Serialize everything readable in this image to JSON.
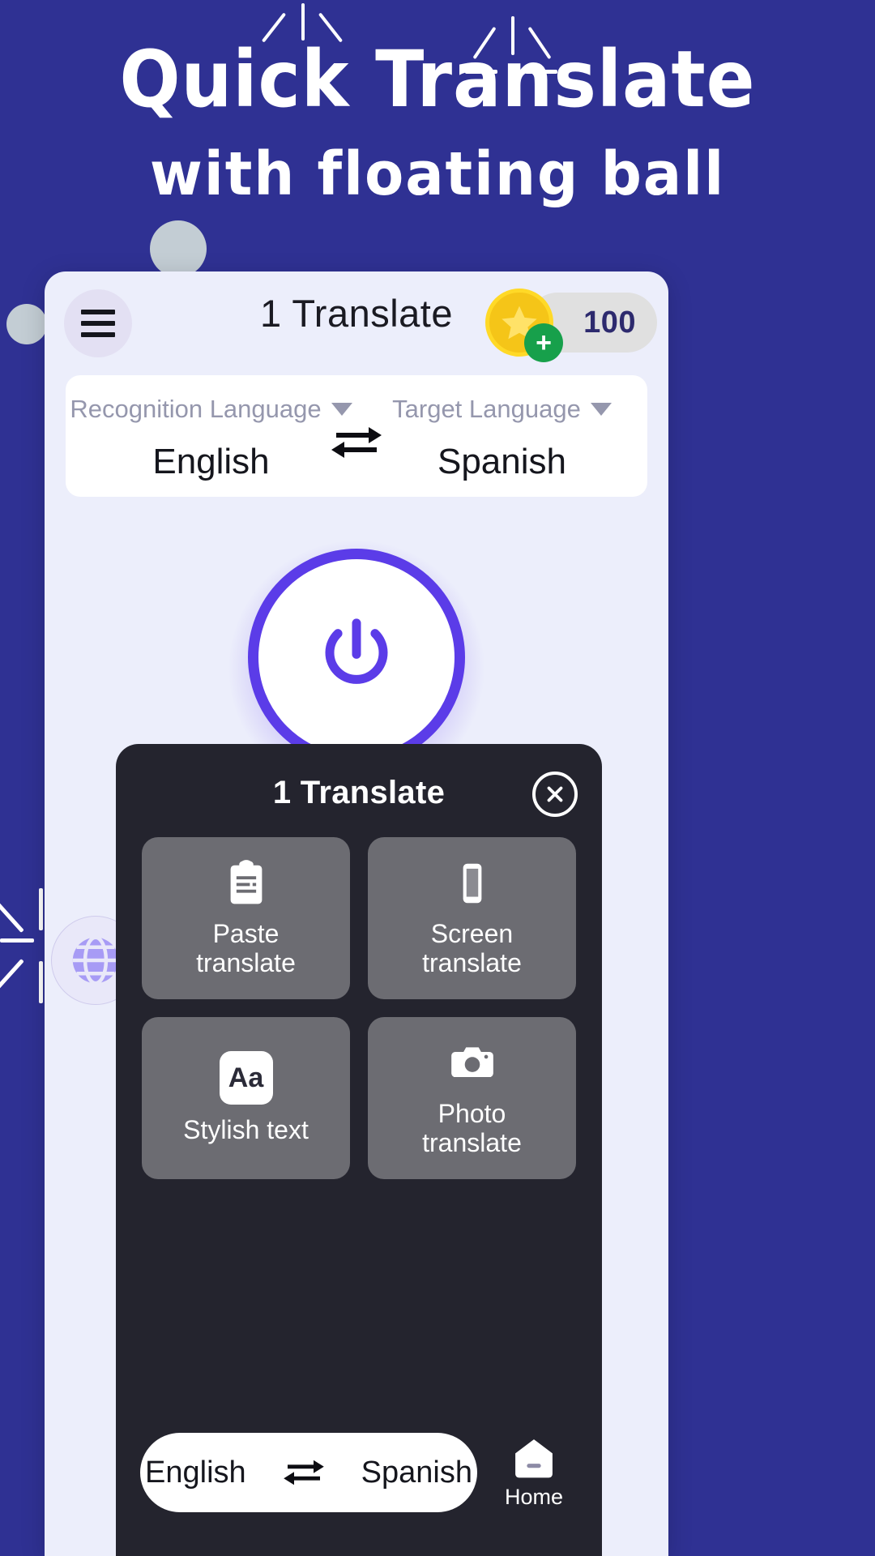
{
  "promo": {
    "headline": "Quick Translate",
    "subheadline": "with floating ball",
    "background_color": "#2f3193",
    "text_color": "#ffffff"
  },
  "app": {
    "header": {
      "menu_icon": "hamburger-menu-icon",
      "title": "1 Translate",
      "coin_icon": "star-coin-icon",
      "add_icon": "plus-icon",
      "points": "100"
    },
    "language_bar": {
      "source": {
        "label": "Recognition Language",
        "value": "English",
        "caret": "chevron-down-icon"
      },
      "target": {
        "label": "Target Language",
        "value": "Spanish",
        "caret": "chevron-down-icon"
      },
      "swap_icon": "swap-arrows-icon"
    },
    "power_button": {
      "icon": "power-icon",
      "accent_color": "#5b3ce8"
    },
    "floating_ball": {
      "icon": "globe-icon",
      "color": "#a79bf5"
    }
  },
  "panel": {
    "title": "1 Translate",
    "close_icon": "close-circle-icon",
    "tiles": [
      {
        "icon": "clipboard-icon",
        "label": "Paste\ntranslate",
        "line1": "Paste",
        "line2": "translate"
      },
      {
        "icon": "phone-screen-icon",
        "label": "Screen translate",
        "line1": "Screen",
        "line2": "translate"
      },
      {
        "icon": "text-style-icon",
        "icon_text": "Aa",
        "label": "Stylish text",
        "line1": "Stylish text",
        "line2": ""
      },
      {
        "icon": "camera-icon",
        "label": "Photo translate",
        "line1": "Photo",
        "line2": "translate"
      }
    ],
    "bottom": {
      "source_lang": "English",
      "target_lang": "Spanish",
      "swap_icon": "swap-arrows-icon",
      "home_icon": "home-icon",
      "home_label": "Home"
    }
  }
}
